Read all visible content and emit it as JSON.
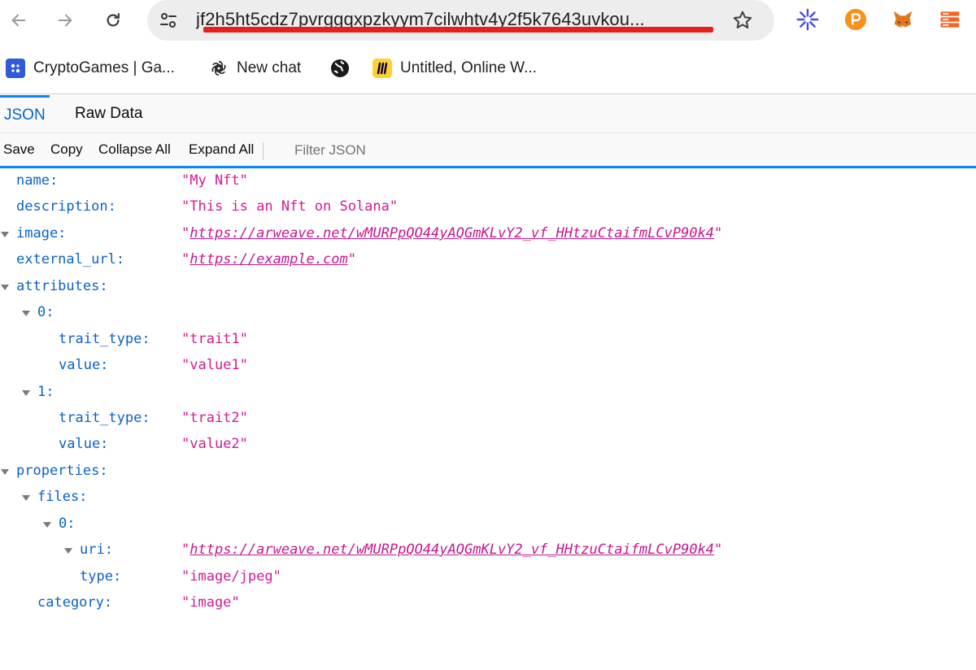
{
  "browser": {
    "url": "jf2h5ht5cdz7pvrggqxpzkyym7cilwhtv4y2f5k7643uvkou...",
    "bookmarks": [
      {
        "label": "CryptoGames | Ga..."
      },
      {
        "label": "New chat"
      },
      {
        "label": ""
      },
      {
        "label": "Untitled, Online W..."
      }
    ]
  },
  "viewer": {
    "tabs": {
      "json": "JSON",
      "raw": "Raw Data"
    },
    "actions": {
      "save": "Save",
      "copy": "Copy",
      "collapse": "Collapse All",
      "expand": "Expand All"
    },
    "filter_placeholder": "Filter JSON"
  },
  "tree": {
    "name": {
      "key": "name:",
      "value": "\"My Nft\""
    },
    "description": {
      "key": "description:",
      "value": "\"This is an Nft on Solana\""
    },
    "image": {
      "key": "image:",
      "value": "https://arweave.net/wMURPpQO44yAQGmKLvY2_vf_HHtzuCtaifmLCvP90k4"
    },
    "external_url": {
      "key": "external_url:",
      "value": "https://example.com"
    },
    "attributes": {
      "key": "attributes:"
    },
    "attr0": {
      "key": "0:",
      "trait_type_key": "trait_type:",
      "trait_type": "\"trait1\"",
      "value_key": "value:",
      "value": "\"value1\""
    },
    "attr1": {
      "key": "1:",
      "trait_type_key": "trait_type:",
      "trait_type": "\"trait2\"",
      "value_key": "value:",
      "value": "\"value2\""
    },
    "properties": {
      "key": "properties:"
    },
    "files": {
      "key": "files:"
    },
    "file0": {
      "key": "0:",
      "uri_key": "uri:",
      "uri": "https://arweave.net/wMURPpQO44yAQGmKLvY2_vf_HHtzuCtaifmLCvP90k4",
      "type_key": "type:",
      "type": "\"image/jpeg\""
    },
    "category": {
      "key": "category:",
      "value": "\"image\""
    }
  },
  "quote": "\""
}
